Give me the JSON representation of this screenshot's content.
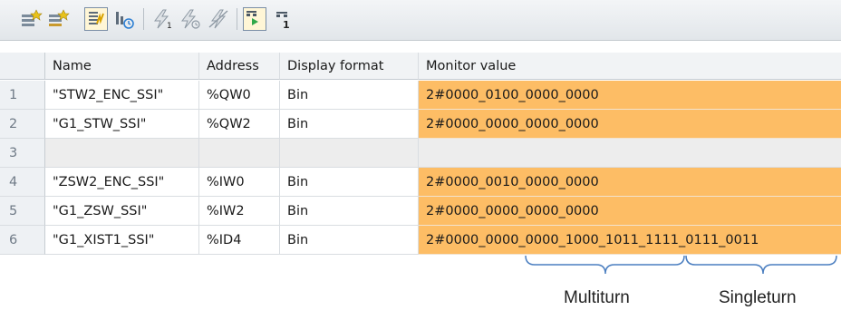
{
  "toolbar": {
    "icons": [
      "insert-row-icon",
      "add-row-icon",
      "monitor-all-icon",
      "monitor-once-icon",
      "modify-value-1-icon",
      "modify-now-icon",
      "modify-disable-icon",
      "enable-peripheral-outputs-icon",
      "force-value-1-icon"
    ]
  },
  "table": {
    "columns": [
      "Name",
      "Address",
      "Display format",
      "Monitor value"
    ],
    "rows": [
      {
        "index": "1",
        "name": "\"STW2_ENC_SSI\"",
        "address": "%QW0",
        "format": "Bin",
        "value": "2#0000_0100_0000_0000"
      },
      {
        "index": "2",
        "name": "\"G1_STW_SSI\"",
        "address": "%QW2",
        "format": "Bin",
        "value": "2#0000_0000_0000_0000"
      },
      {
        "index": "3",
        "name": "",
        "address": "",
        "format": "",
        "value": ""
      },
      {
        "index": "4",
        "name": "\"ZSW2_ENC_SSI\"",
        "address": "%IW0",
        "format": "Bin",
        "value": "2#0000_0010_0000_0000"
      },
      {
        "index": "5",
        "name": "\"G1_ZSW_SSI\"",
        "address": "%IW2",
        "format": "Bin",
        "value": "2#0000_0000_0000_0000"
      },
      {
        "index": "6",
        "name": "\"G1_XIST1_SSI\"",
        "address": "%ID4",
        "format": "Bin",
        "value": "2#0000_0000_0000_1000_1011_1111_0111_0011"
      }
    ]
  },
  "annotations": {
    "multiturn": "Multiturn",
    "singleturn": "Singleturn",
    "brace_color": "#4a7ec0"
  },
  "colors": {
    "monitor_value_bg": "#fdbd65",
    "empty_row_bg": "#ededed"
  }
}
